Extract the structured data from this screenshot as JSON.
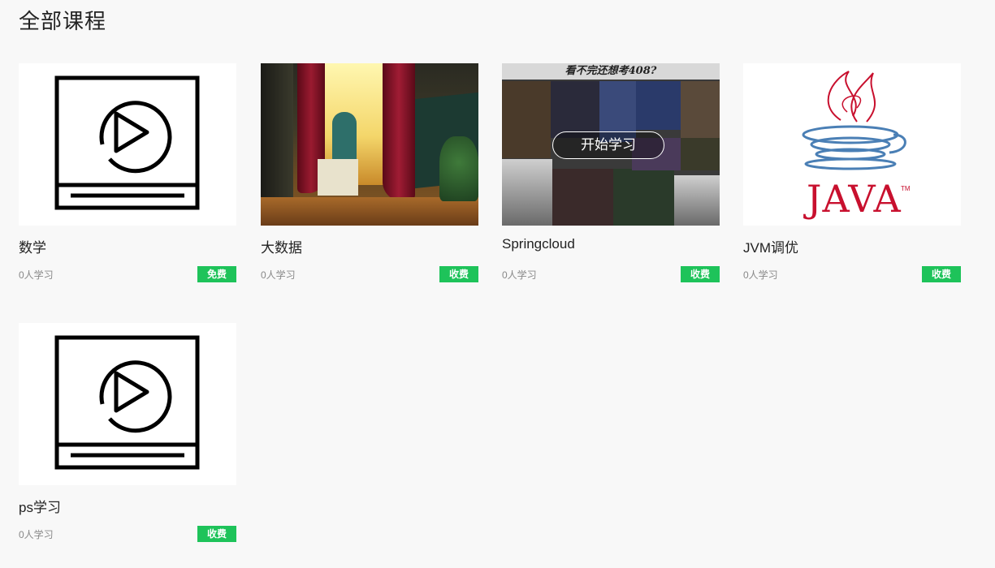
{
  "page": {
    "title": "全部课程"
  },
  "courses": [
    {
      "title": "数学",
      "learners": "0人学习",
      "badge": "免费",
      "thumb_icon": "video-player-icon"
    },
    {
      "title": "大数据",
      "learners": "0人学习",
      "badge": "收费",
      "thumb_icon": "classroom-illustration"
    },
    {
      "title": "Springcloud",
      "learners": "0人学习",
      "badge": "收费",
      "thumb_icon": "book-collage",
      "hover_button": "开始学习",
      "collage_caption": "看不完还想考408?"
    },
    {
      "title": "JVM调优",
      "learners": "0人学习",
      "badge": "收费",
      "thumb_icon": "java-logo",
      "logo_text": "JAVA",
      "logo_tm": "TM"
    },
    {
      "title": "ps学习",
      "learners": "0人学习",
      "badge": "收费",
      "thumb_icon": "video-player-icon"
    }
  ],
  "colors": {
    "badge": "#1ec35a",
    "background": "#f8f8f8",
    "java_red": "#c8102e",
    "java_blue": "#4a7fb5"
  }
}
